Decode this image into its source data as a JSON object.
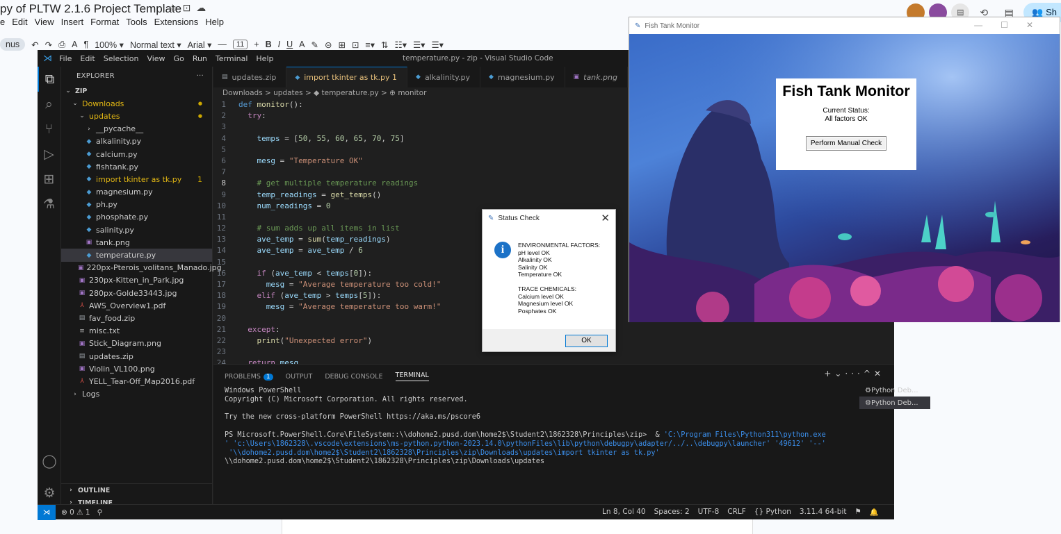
{
  "gdocs": {
    "title": "py of PLTW 2.1.6 Project Template",
    "title_icons": [
      "star-icon",
      "folder-icon",
      "cloud-icon"
    ],
    "menu": [
      "e",
      "Edit",
      "View",
      "Insert",
      "Format",
      "Tools",
      "Extensions",
      "Help"
    ],
    "toolbar": {
      "mode": "nus",
      "zoom": "100%",
      "style": "Normal text",
      "font": "Arial",
      "size": "11"
    },
    "share_label": "Sh"
  },
  "vscode": {
    "menu": [
      "File",
      "Edit",
      "Selection",
      "View",
      "Go",
      "Run",
      "Terminal",
      "Help"
    ],
    "window_title": "temperature.py - zip - Visual Studio Code",
    "explorer_title": "EXPLORER",
    "explorer_more": "···",
    "tree": [
      {
        "label": "ZIP",
        "indent": 0,
        "icon": "chevron-down",
        "bold": true
      },
      {
        "label": "Downloads",
        "indent": 1,
        "icon": "chevron-down",
        "color": "#e2b714",
        "badge": "●"
      },
      {
        "label": "updates",
        "indent": 2,
        "icon": "chevron-down",
        "color": "#e2b714",
        "badge": "●"
      },
      {
        "label": "__pycache__",
        "indent": 3,
        "icon": "chevron-right"
      },
      {
        "label": "alkalinity.py",
        "indent": 3,
        "icon": "py"
      },
      {
        "label": "calcium.py",
        "indent": 3,
        "icon": "py"
      },
      {
        "label": "fishtank.py",
        "indent": 3,
        "icon": "py"
      },
      {
        "label": "import tkinter as tk.py",
        "indent": 3,
        "icon": "py",
        "color": "#e2b714",
        "badge": "1"
      },
      {
        "label": "magnesium.py",
        "indent": 3,
        "icon": "py"
      },
      {
        "label": "ph.py",
        "indent": 3,
        "icon": "py"
      },
      {
        "label": "phosphate.py",
        "indent": 3,
        "icon": "py"
      },
      {
        "label": "salinity.py",
        "indent": 3,
        "icon": "py"
      },
      {
        "label": "tank.png",
        "indent": 3,
        "icon": "img"
      },
      {
        "label": "temperature.py",
        "indent": 3,
        "icon": "py",
        "selected": true
      },
      {
        "label": "220px-Pterois_volitans_Manado.jpg",
        "indent": 2,
        "icon": "img"
      },
      {
        "label": "230px-Kitten_in_Park.jpg",
        "indent": 2,
        "icon": "img"
      },
      {
        "label": "280px-Golde33443.jpg",
        "indent": 2,
        "icon": "img"
      },
      {
        "label": "AWS_Overview1.pdf",
        "indent": 2,
        "icon": "pdf"
      },
      {
        "label": "fav_food.zip",
        "indent": 2,
        "icon": "zip"
      },
      {
        "label": "misc.txt",
        "indent": 2,
        "icon": "txt"
      },
      {
        "label": "Stick_Diagram.png",
        "indent": 2,
        "icon": "img"
      },
      {
        "label": "updates.zip",
        "indent": 2,
        "icon": "zip"
      },
      {
        "label": "Violin_VL100.png",
        "indent": 2,
        "icon": "img"
      },
      {
        "label": "YELL_Tear-Off_Map2016.pdf",
        "indent": 2,
        "icon": "pdf"
      },
      {
        "label": "Logs",
        "indent": 1,
        "icon": "chevron-right"
      }
    ],
    "outline": "OUTLINE",
    "timeline": "TIMELINE",
    "tabs": [
      {
        "label": "updates.zip",
        "icon": "zip"
      },
      {
        "label": "import tkinter as tk.py 1",
        "icon": "py",
        "active": true
      },
      {
        "label": "alkalinity.py",
        "icon": "py"
      },
      {
        "label": "magnesium.py",
        "icon": "py"
      },
      {
        "label": "tank.png",
        "icon": "img"
      }
    ],
    "breadcrumb": "Downloads > updates > ◆ temperature.py > ⊕ monitor",
    "code": [
      {
        "n": "1",
        "html": "<span class='bl'>def</span> <span class='fn'>monitor</span>():"
      },
      {
        "n": "2",
        "html": "  <span class='kw'>try</span>:"
      },
      {
        "n": "3",
        "html": ""
      },
      {
        "n": "4",
        "html": "    <span class='vr'>temps</span> = [<span class='num'>50</span>, <span class='num'>55</span>, <span class='num'>60</span>, <span class='num'>65</span>, <span class='num'>70</span>, <span class='num'>75</span>]"
      },
      {
        "n": "5",
        "html": ""
      },
      {
        "n": "6",
        "html": "    <span class='vr'>mesg</span> = <span class='str'>\"Temperature OK\"</span>"
      },
      {
        "n": "7",
        "html": ""
      },
      {
        "n": "8",
        "html": "    <span class='cm'># get multiple temperature readings</span>"
      },
      {
        "n": "9",
        "html": "    <span class='vr'>temp_readings</span> = <span class='fn'>get_temps</span>()"
      },
      {
        "n": "10",
        "html": "    <span class='vr'>num_readings</span> = <span class='num'>0</span>"
      },
      {
        "n": "11",
        "html": ""
      },
      {
        "n": "12",
        "html": "    <span class='cm'># sum adds up all items in list</span>"
      },
      {
        "n": "13",
        "html": "    <span class='vr'>ave_temp</span> = <span class='fn'>sum</span>(<span class='vr'>temp_readings</span>)"
      },
      {
        "n": "14",
        "html": "    <span class='vr'>ave_temp</span> = <span class='vr'>ave_temp</span> / <span class='num'>6</span>"
      },
      {
        "n": "15",
        "html": ""
      },
      {
        "n": "16",
        "html": "    <span class='kw'>if</span> (<span class='vr'>ave_temp</span> &lt; <span class='vr'>temps</span>[<span class='num'>0</span>]):"
      },
      {
        "n": "17",
        "html": "      <span class='vr'>mesg</span> = <span class='str'>\"Average temperature too cold!\"</span>"
      },
      {
        "n": "18",
        "html": "    <span class='kw'>elif</span> (<span class='vr'>ave_temp</span> &gt; <span class='vr'>temps</span>[<span class='num'>5</span>]):"
      },
      {
        "n": "19",
        "html": "      <span class='vr'>mesg</span> = <span class='str'>\"Average temperature too warm!\"</span>"
      },
      {
        "n": "20",
        "html": ""
      },
      {
        "n": "21",
        "html": "  <span class='kw'>except</span>:"
      },
      {
        "n": "22",
        "html": "    <span class='fn'>print</span>(<span class='str'>\"Unexpected error\"</span>)"
      },
      {
        "n": "23",
        "html": ""
      },
      {
        "n": "24",
        "html": "  <span class='kw'>return</span> <span class='vr'>mesg</span>"
      }
    ],
    "current_line": "8",
    "panel_tabs": {
      "problems": "PROBLEMS",
      "problems_count": "1",
      "output": "OUTPUT",
      "debug": "DEBUG CONSOLE",
      "terminal": "TERMINAL"
    },
    "terminal_lines": [
      {
        "t": "Windows PowerShell"
      },
      {
        "t": "Copyright (C) Microsoft Corporation. All rights reserved."
      },
      {
        "t": ""
      },
      {
        "t": "Try the new cross-platform PowerShell https://aka.ms/pscore6"
      },
      {
        "t": ""
      },
      {
        "t": "PS Microsoft.PowerShell.Core\\FileSystem::\\\\dohome2.pusd.dom\\home2$\\Student2\\1862328\\Principles\\zip>  & ",
        "blue": "'C:\\Program Files\\Python311\\python.exe"
      },
      {
        "t": "",
        "blue": "' 'c:\\Users\\1862328\\.vscode\\extensions\\ms-python.python-2023.14.0\\pythonFiles\\lib\\python\\debugpy\\adapter/../..\\debugpy\\launcher' '49612' '--'"
      },
      {
        "t": "",
        "blue": " '\\\\dohome2.pusd.dom\\home2$\\Student2\\1862328\\Principles\\zip\\Downloads\\updates\\import tkinter as tk.py'"
      },
      {
        "t": "\\\\dohome2.pusd.dom\\home2$\\Student2\\1862328\\Principles\\zip\\Downloads\\updates"
      }
    ],
    "terminal_sessions": [
      "Python Deb...",
      "Python Deb..."
    ],
    "status": {
      "errors": "⊗ 0 ⚠ 1",
      "position": "Ln 8, Col 40",
      "spaces": "Spaces: 2",
      "encoding": "UTF-8",
      "eol": "CRLF",
      "language": "{} Python",
      "interpreter": "3.11.4 64-bit"
    }
  },
  "fish": {
    "window_title": "Fish Tank Monitor",
    "heading": "Fish Tank Monitor",
    "status_label": "Current Status:",
    "status_value": "All factors OK",
    "button": "Perform Manual Check"
  },
  "dialog": {
    "title": "Status Check",
    "lines": [
      "ENVIRONMENTAL FACTORS:",
      "pH level OK",
      "Alkalinity OK",
      "Salinity OK",
      "Temperature OK",
      "",
      "TRACE CHEMICALS:",
      "Calcium level OK",
      "Magnesium level OK",
      "Posphates OK"
    ],
    "ok": "OK"
  }
}
